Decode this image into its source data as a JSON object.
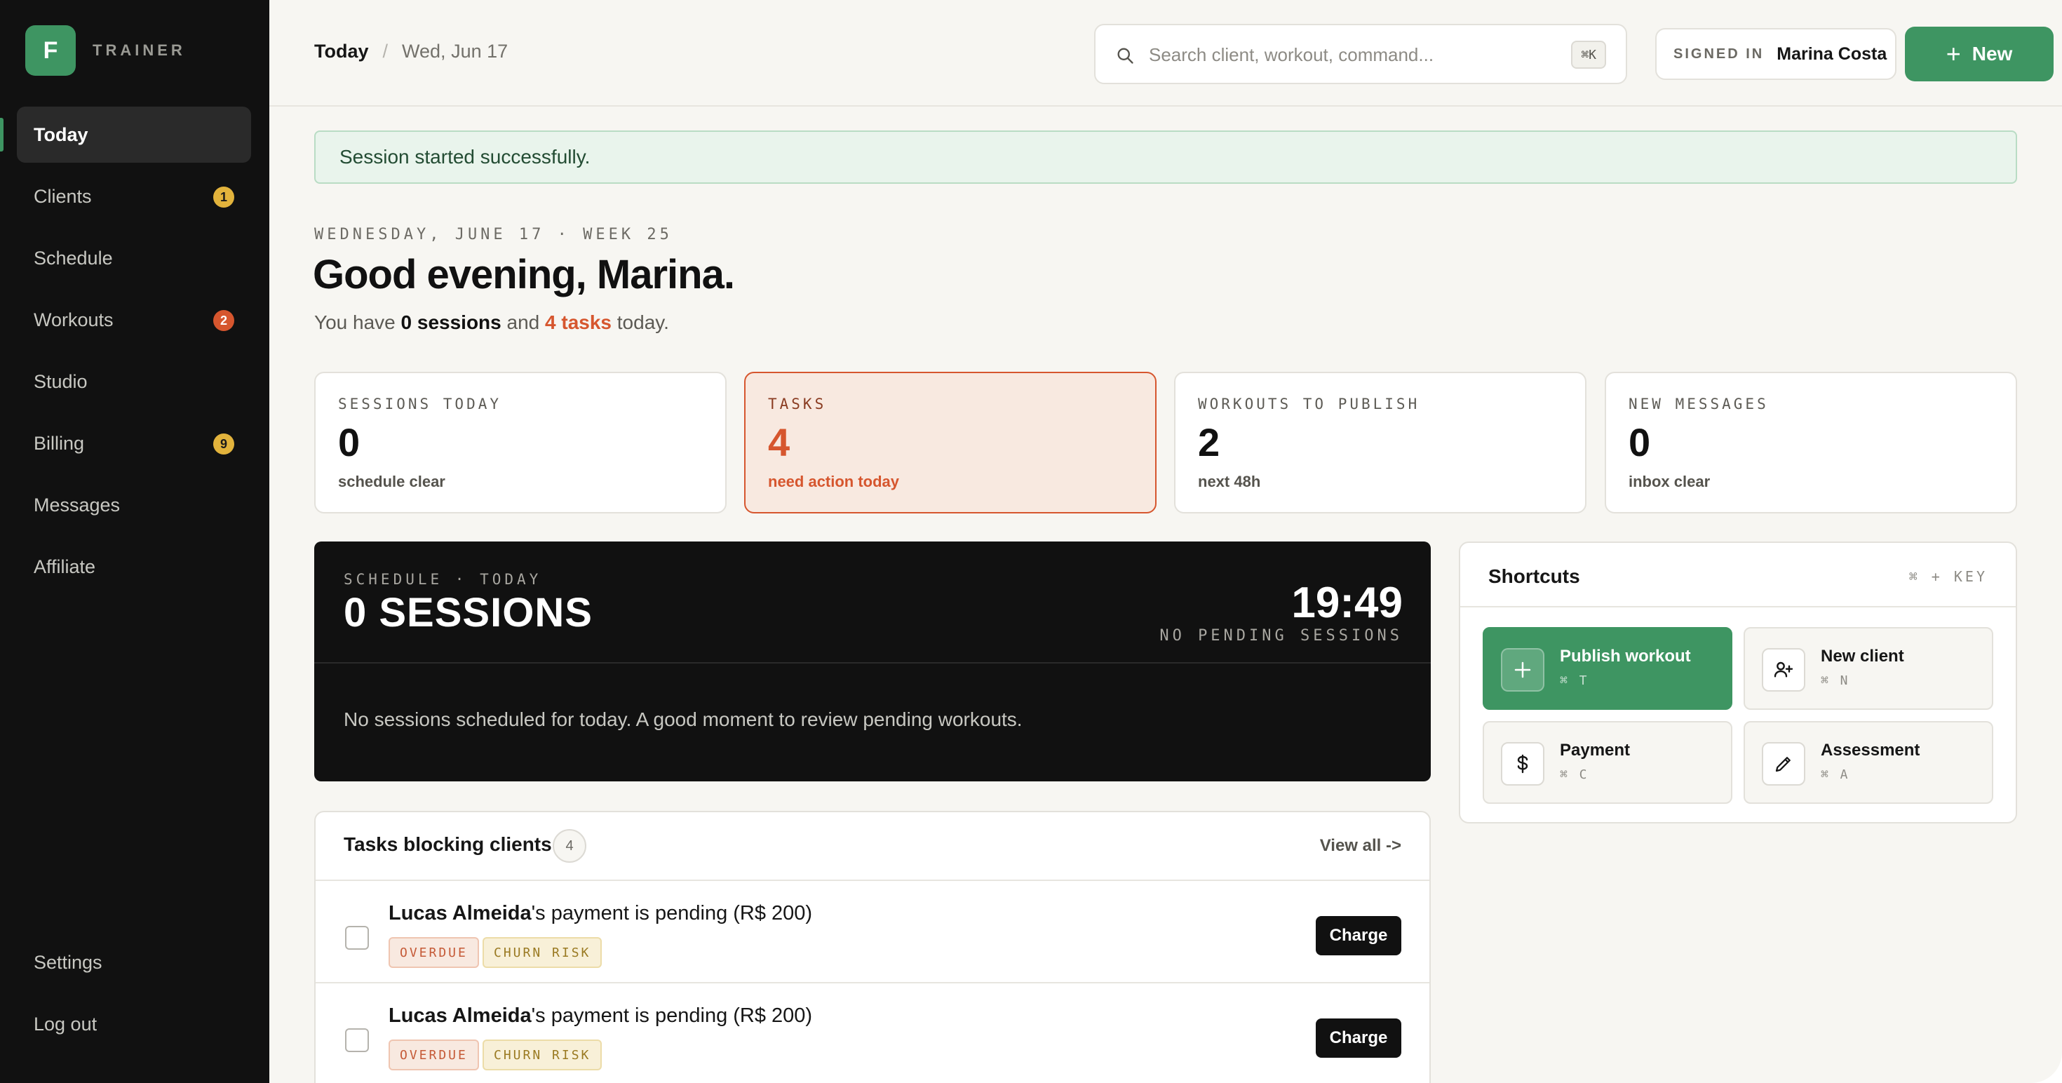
{
  "brand": {
    "logo_letter": "F",
    "name": "TRAINER",
    "accent": "#3e9562"
  },
  "sidebar": {
    "items": [
      {
        "label": "Today",
        "active": true
      },
      {
        "label": "Clients",
        "badge": "1",
        "badge_color": "#e2b33c"
      },
      {
        "label": "Schedule"
      },
      {
        "label": "Workouts",
        "badge": "2",
        "badge_color": "#d6562e"
      },
      {
        "label": "Studio"
      },
      {
        "label": "Billing",
        "badge": "9",
        "badge_color": "#e2b33c"
      },
      {
        "label": "Messages"
      },
      {
        "label": "Affiliate"
      }
    ],
    "bottom": [
      {
        "label": "Settings"
      },
      {
        "label": "Log out"
      }
    ]
  },
  "header": {
    "crumb_today": "Today",
    "crumb_sep": "/",
    "crumb_date": "Wed, Jun 17",
    "search_placeholder": "Search client, workout, command...",
    "search_shortcut": "⌘K",
    "signed_label": "SIGNED IN",
    "signed_name": "Marina Costa",
    "new_plus": "+",
    "new_label": "New"
  },
  "alert": {
    "text": "Session started successfully."
  },
  "hero": {
    "eyebrow": "WEDNESDAY, JUNE 17 · WEEK 25",
    "greeting": "Good evening, Marina.",
    "summary_prefix": "You have ",
    "summary_sessions": "0 sessions",
    "summary_mid": " and ",
    "summary_tasks": "4 tasks",
    "summary_suffix": " today."
  },
  "stats": [
    {
      "label": "SESSIONS TODAY",
      "value": "0",
      "sub": "schedule clear"
    },
    {
      "label": "TASKS",
      "value": "4",
      "sub": "need action today",
      "highlight": true
    },
    {
      "label": "WORKOUTS TO PUBLISH",
      "value": "2",
      "sub": "next 48h"
    },
    {
      "label": "NEW MESSAGES",
      "value": "0",
      "sub": "inbox clear"
    }
  ],
  "schedule": {
    "label": "SCHEDULE · TODAY",
    "title": "0 SESSIONS",
    "time": "19:49",
    "pending": "NO PENDING SESSIONS",
    "empty": "No sessions scheduled for today. A good moment to review pending workouts."
  },
  "shortcuts": {
    "title": "Shortcuts",
    "hint": "⌘ + KEY",
    "items": [
      {
        "label": "Publish workout",
        "key": "⌘ T",
        "icon": "plus-icon",
        "primary": true
      },
      {
        "label": "New client",
        "key": "⌘ N",
        "icon": "user-plus-icon"
      },
      {
        "label": "Payment",
        "key": "⌘ C",
        "icon": "dollar-icon"
      },
      {
        "label": "Assessment",
        "key": "⌘ A",
        "icon": "pencil-icon"
      }
    ]
  },
  "tasks": {
    "title": "Tasks blocking clients",
    "count": "4",
    "view_all": "View all ->",
    "rows": [
      {
        "name": "Lucas Almeida",
        "text": "'s payment is pending (R$ 200)",
        "tags": [
          "OVERDUE",
          "CHURN RISK"
        ],
        "action": "Charge"
      },
      {
        "name": "Lucas Almeida",
        "text": "'s payment is pending (R$ 200)",
        "tags": [
          "OVERDUE",
          "CHURN RISK"
        ],
        "action": "Charge"
      }
    ]
  }
}
